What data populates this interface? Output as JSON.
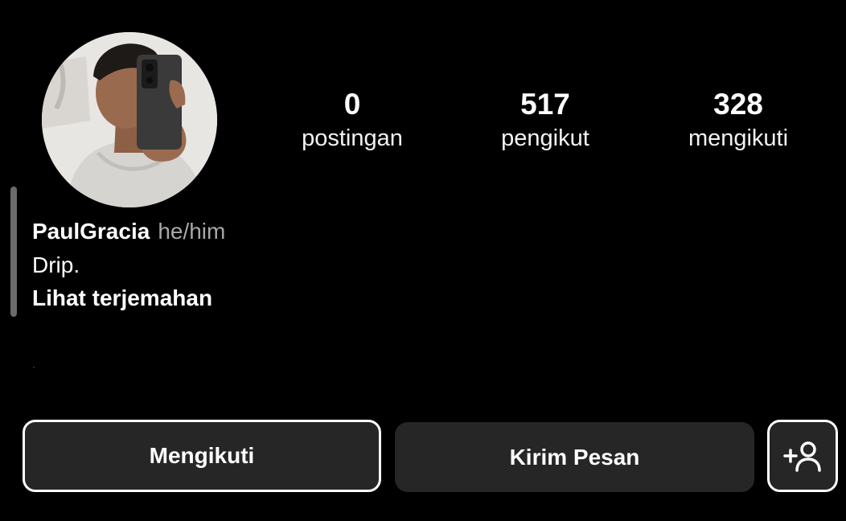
{
  "profile": {
    "username": "PaulGracia",
    "pronouns": "he/him",
    "bio": "Drip.",
    "translate_label": "Lihat terjemahan"
  },
  "stats": {
    "posts": {
      "count": "0",
      "label": "postingan"
    },
    "followers": {
      "count": "517",
      "label": "pengikut"
    },
    "following": {
      "count": "328",
      "label": "mengikuti"
    }
  },
  "actions": {
    "following_label": "Mengikuti",
    "message_label": "Kirim Pesan",
    "suggest_icon": "add-person-icon"
  },
  "colors": {
    "background": "#000000",
    "button_bg": "#262626",
    "text": "#ffffff",
    "secondary_text": "#a8a8a8"
  }
}
